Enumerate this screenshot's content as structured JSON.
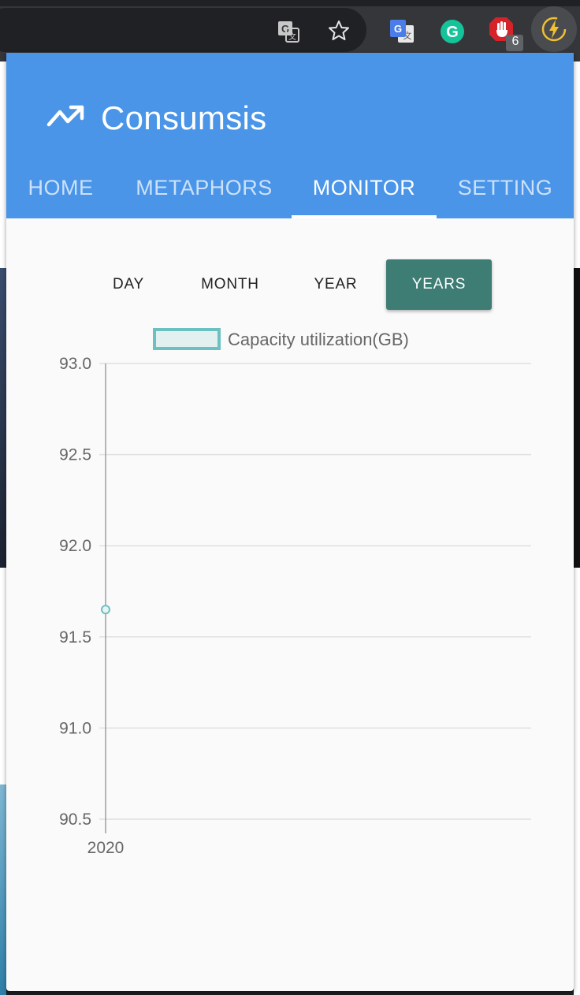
{
  "browser": {
    "extension_badge_count": "6",
    "icons": [
      "translate-page-icon",
      "bookmark-star-icon",
      "google-translate-extension-icon",
      "grammarly-extension-icon",
      "adblock-extension-icon",
      "consumsis-extension-icon"
    ]
  },
  "app": {
    "title": "Consumsis",
    "logo_icon": "trending-chart-icon",
    "brand_color": "#4a95e8",
    "tabs": [
      {
        "label": "HOME",
        "active": false
      },
      {
        "label": "METAPHORS",
        "active": false
      },
      {
        "label": "MONITOR",
        "active": true
      },
      {
        "label": "SETTING",
        "active": false
      }
    ],
    "periods": [
      {
        "label": "DAY",
        "active": false
      },
      {
        "label": "MONTH",
        "active": false
      },
      {
        "label": "YEAR",
        "active": false
      },
      {
        "label": "YEARS",
        "active": true
      }
    ],
    "active_period_color": "#3d7d73"
  },
  "chart_data": {
    "type": "line",
    "title": "",
    "legend": "top-center",
    "series": [
      {
        "name": "Capacity utilization(GB)",
        "color": "#6cc0c2",
        "x": [
          "2020"
        ],
        "values": [
          91.65
        ]
      }
    ],
    "categories": [
      "2020"
    ],
    "ylim": [
      90.5,
      93.0
    ],
    "y_ticks": [
      "93.0",
      "92.5",
      "92.0",
      "91.5",
      "91.0",
      "90.5"
    ],
    "grid": true
  }
}
